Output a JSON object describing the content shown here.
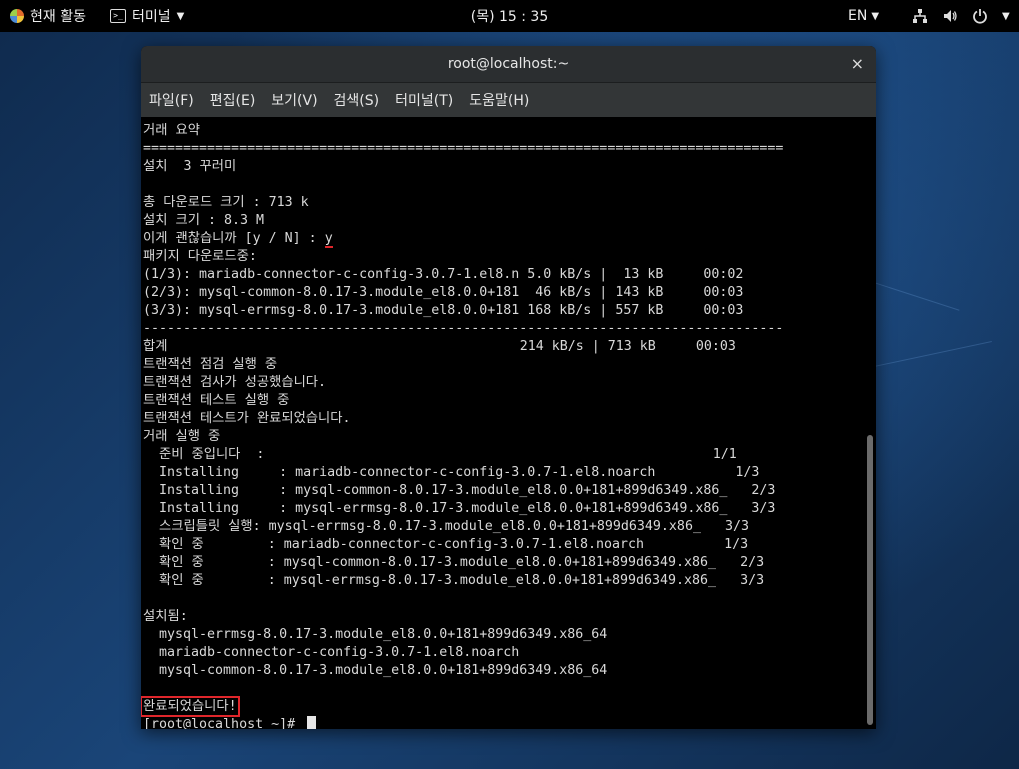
{
  "topbar": {
    "activities_label": "현재 활동",
    "app_menu_label": "터미널",
    "clock": "(목) 15 : 35",
    "language": "EN"
  },
  "window": {
    "title": "root@localhost:~",
    "close_glyph": "×"
  },
  "menubar": {
    "items": [
      "파일(F)",
      "편집(E)",
      "보기(V)",
      "검색(S)",
      "터미널(T)",
      "도움말(H)"
    ]
  },
  "terminal": {
    "lines": [
      "거래 요약",
      "================================================================================",
      "설치  3 꾸러미",
      "",
      "총 다운로드 크기 : 713 k",
      "설치 크기 : 8.3 M",
      "이게 괜찮습니까 [y / N] : ",
      "패키지 다운로드중:",
      "(1/3): mariadb-connector-c-config-3.0.7-1.el8.n 5.0 kB/s |  13 kB     00:02",
      "(2/3): mysql-common-8.0.17-3.module_el8.0.0+181  46 kB/s | 143 kB     00:03",
      "(3/3): mysql-errmsg-8.0.17-3.module_el8.0.0+181 168 kB/s | 557 kB     00:03",
      "--------------------------------------------------------------------------------",
      "합계                                            214 kB/s | 713 kB     00:03",
      "트랜잭션 점검 실행 중",
      "트랜잭션 검사가 성공했습니다.",
      "트랜잭션 테스트 실행 중",
      "트랜잭션 테스트가 완료되었습니다.",
      "거래 실행 중",
      "  준비 중입니다  :                                                        1/1",
      "  Installing     : mariadb-connector-c-config-3.0.7-1.el8.noarch          1/3",
      "  Installing     : mysql-common-8.0.17-3.module_el8.0.0+181+899d6349.x86_   2/3",
      "  Installing     : mysql-errmsg-8.0.17-3.module_el8.0.0+181+899d6349.x86_   3/3",
      "  스크립틀릿 실행: mysql-errmsg-8.0.17-3.module_el8.0.0+181+899d6349.x86_   3/3",
      "  확인 중        : mariadb-connector-c-config-3.0.7-1.el8.noarch          1/3",
      "  확인 중        : mysql-common-8.0.17-3.module_el8.0.0+181+899d6349.x86_   2/3",
      "  확인 중        : mysql-errmsg-8.0.17-3.module_el8.0.0+181+899d6349.x86_   3/3",
      "",
      "설치됨:",
      "  mysql-errmsg-8.0.17-3.module_el8.0.0+181+899d6349.x86_64",
      "  mariadb-connector-c-config-3.0.7-1.el8.noarch",
      "  mysql-common-8.0.17-3.module_el8.0.0+181+899d6349.x86_64",
      ""
    ],
    "confirm_answer": "y",
    "complete_message": "완료되었습니다!",
    "prompt": "[root@localhost ~]# "
  },
  "colors": {
    "highlight": "#e0262b",
    "terminal_bg": "#000000",
    "terminal_fg": "#d9d9d9"
  }
}
